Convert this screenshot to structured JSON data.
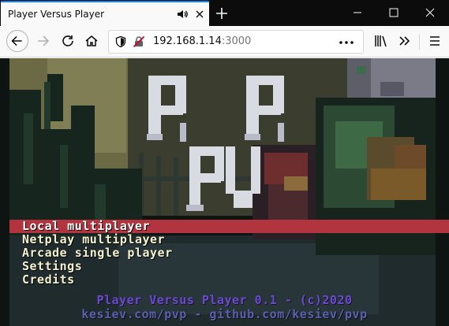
{
  "browser": {
    "tab_title": "Player Versus Player",
    "url_host": "192.168.1.14",
    "url_port": ":3000",
    "icons": [
      "audio-icon",
      "close-icon",
      "plus-icon",
      "back-icon",
      "forward-icon",
      "reload-icon",
      "home-icon",
      "shield-icon",
      "insecure-lock-icon",
      "more-icon",
      "library-icon",
      "overflow-icon",
      "hamburger-icon"
    ]
  },
  "game": {
    "logo_alt": "PvP",
    "menu": [
      {
        "label": "Local multiplayer",
        "selected": true
      },
      {
        "label": "Netplay multiplayer",
        "selected": false
      },
      {
        "label": "Arcade single player",
        "selected": false
      },
      {
        "label": "Settings",
        "selected": false
      },
      {
        "label": "Credits",
        "selected": false
      }
    ],
    "footer_line1": "Player Versus Player 0.1 - (c)2020",
    "footer_line2": "kesiev.com/pvp - github.com/kesiev/pvp",
    "colors": {
      "selected": "#b1343f",
      "menu_text": "#f4f2cf",
      "footer1": "#6a4cc8",
      "footer2": "#5a5fb0"
    }
  }
}
